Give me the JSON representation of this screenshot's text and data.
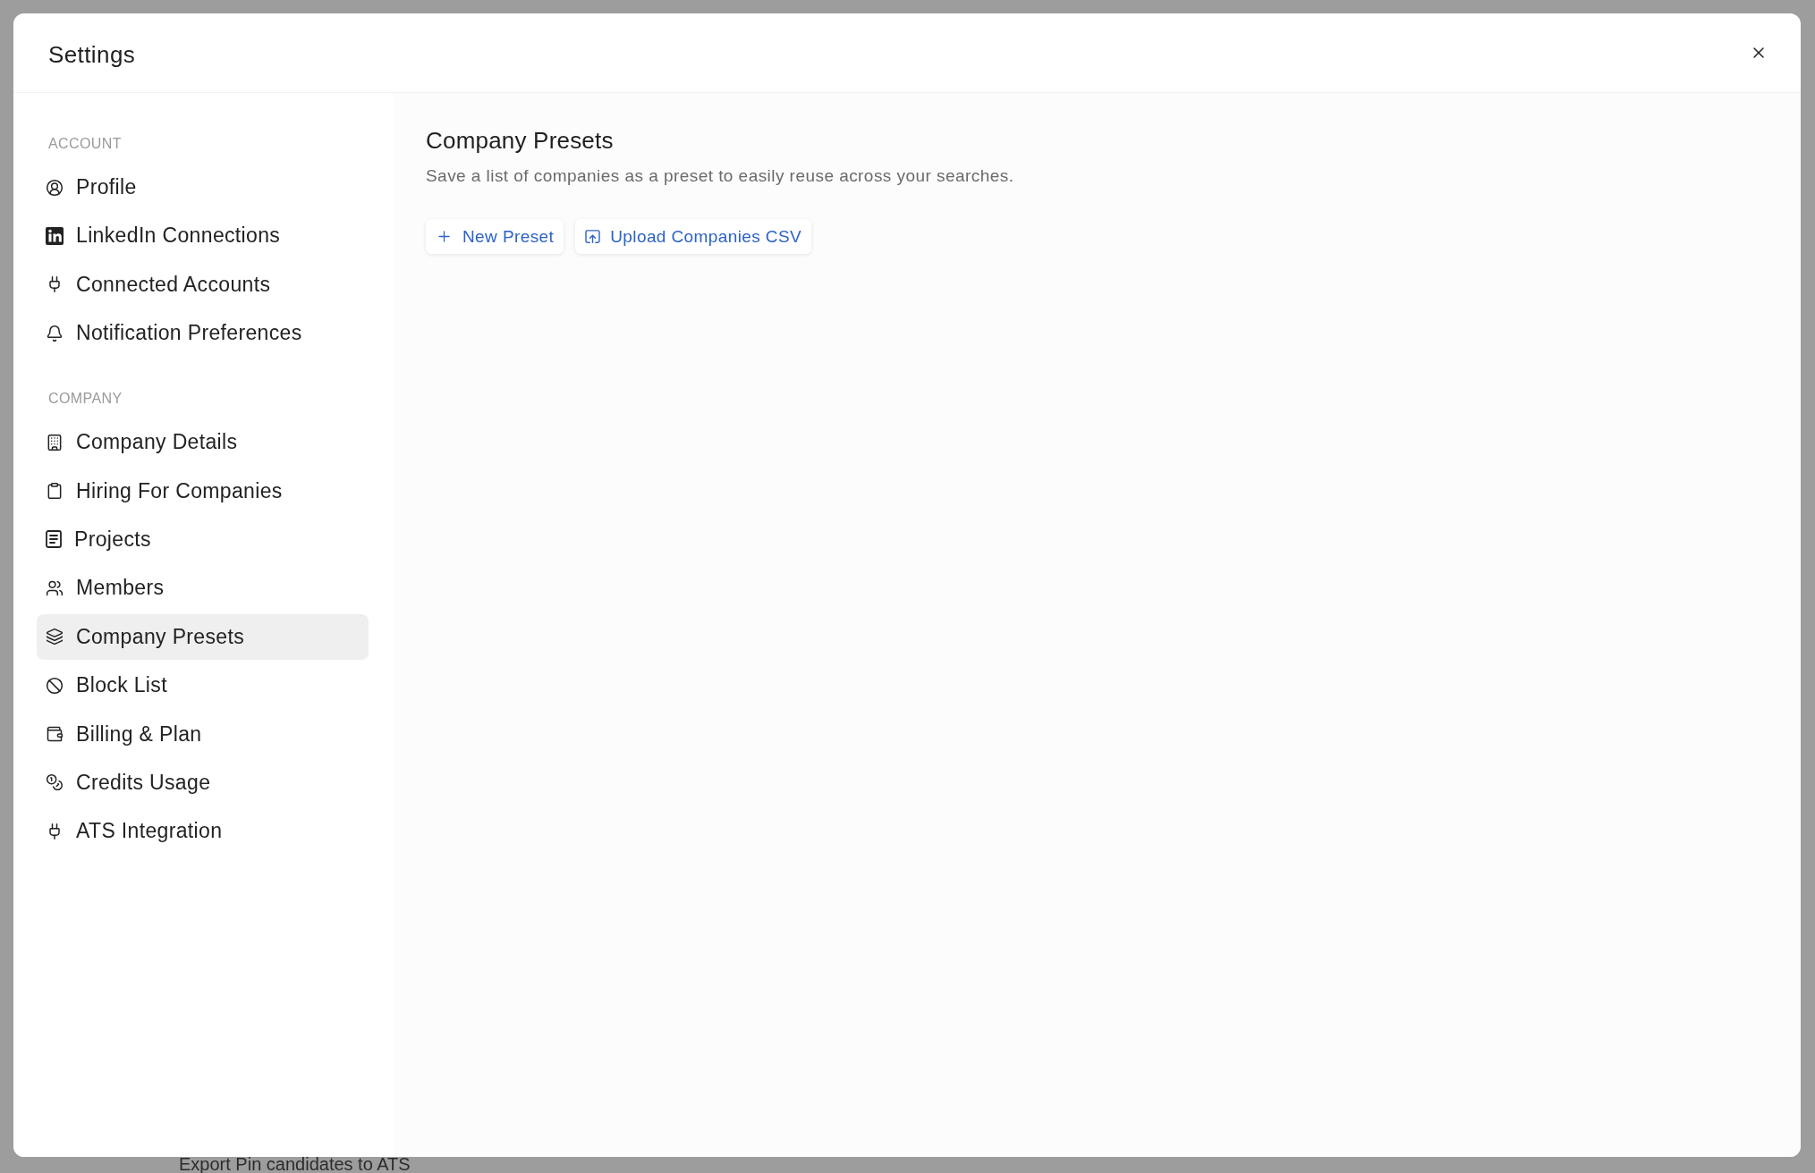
{
  "background_page": {
    "bottom_text": "Export Pin candidates to ATS"
  },
  "dialog": {
    "title": "Settings"
  },
  "sidebar": {
    "sections": [
      {
        "heading": "ACCOUNT",
        "items": [
          {
            "label": "Profile",
            "selected": false
          },
          {
            "label": "LinkedIn Connections",
            "selected": false
          },
          {
            "label": "Connected Accounts",
            "selected": false
          },
          {
            "label": "Notification Preferences",
            "selected": false
          }
        ]
      },
      {
        "heading": "COMPANY",
        "items": [
          {
            "label": "Company Details",
            "selected": false
          },
          {
            "label": "Hiring For Companies",
            "selected": false
          },
          {
            "label": "Projects",
            "selected": false
          },
          {
            "label": "Members",
            "selected": false
          },
          {
            "label": "Company Presets",
            "selected": true
          },
          {
            "label": "Block List",
            "selected": false
          },
          {
            "label": "Billing & Plan",
            "selected": false
          },
          {
            "label": "Credits Usage",
            "selected": false
          },
          {
            "label": "ATS Integration",
            "selected": false
          }
        ]
      }
    ]
  },
  "content": {
    "title": "Company Presets",
    "description": "Save a list of companies as a preset to easily reuse across your searches.",
    "buttons": [
      {
        "label": "New Preset"
      },
      {
        "label": "Upload Companies CSV"
      }
    ]
  }
}
